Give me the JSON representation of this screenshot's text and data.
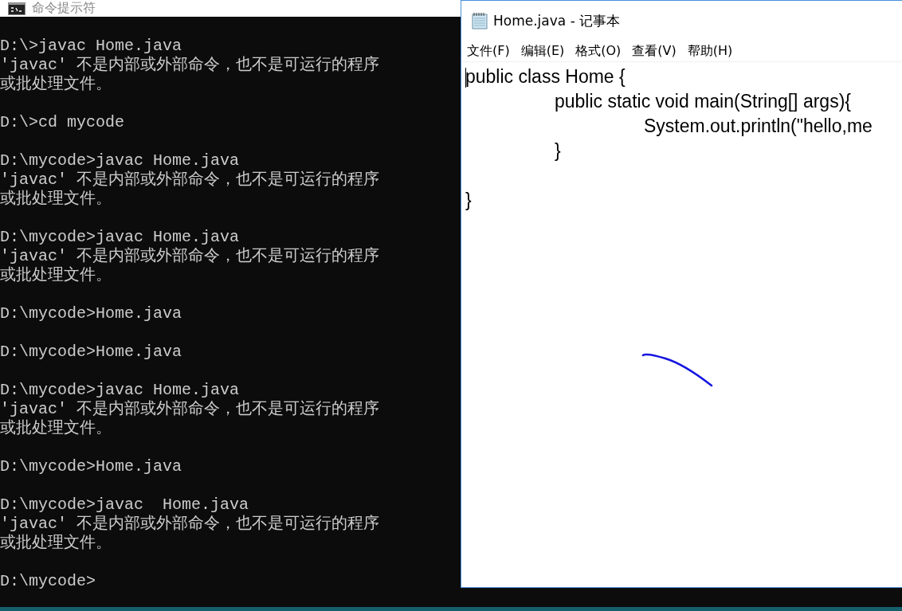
{
  "console_window": {
    "title": "命令提示符",
    "blocks": [
      [
        "D:\\>javac Home.java",
        "'javac' 不是内部或外部命令，也不是可运行的程序",
        "或批处理文件。"
      ],
      [
        "D:\\>cd mycode"
      ],
      [
        "D:\\mycode>javac Home.java",
        "'javac' 不是内部或外部命令，也不是可运行的程序",
        "或批处理文件。"
      ],
      [
        "D:\\mycode>javac Home.java",
        "'javac' 不是内部或外部命令，也不是可运行的程序",
        "或批处理文件。"
      ],
      [
        "D:\\mycode>Home.java"
      ],
      [
        "D:\\mycode>Home.java"
      ],
      [
        "D:\\mycode>javac Home.java",
        "'javac' 不是内部或外部命令，也不是可运行的程序",
        "或批处理文件。"
      ],
      [
        "D:\\mycode>Home.java"
      ],
      [
        "D:\\mycode>javac  Home.java",
        "'javac' 不是内部或外部命令，也不是可运行的程序",
        "或批处理文件。"
      ],
      [
        "D:\\mycode>"
      ]
    ]
  },
  "notepad_window": {
    "title": "Home.java - 记事本",
    "menu": [
      "文件(F)",
      "编辑(E)",
      "格式(O)",
      "查看(V)",
      "帮助(H)"
    ],
    "text": "public class Home {\n\tpublic static void main(String[] args){\n\t\tSystem.out.println(\"hello,me\n\t}\n\n}"
  }
}
